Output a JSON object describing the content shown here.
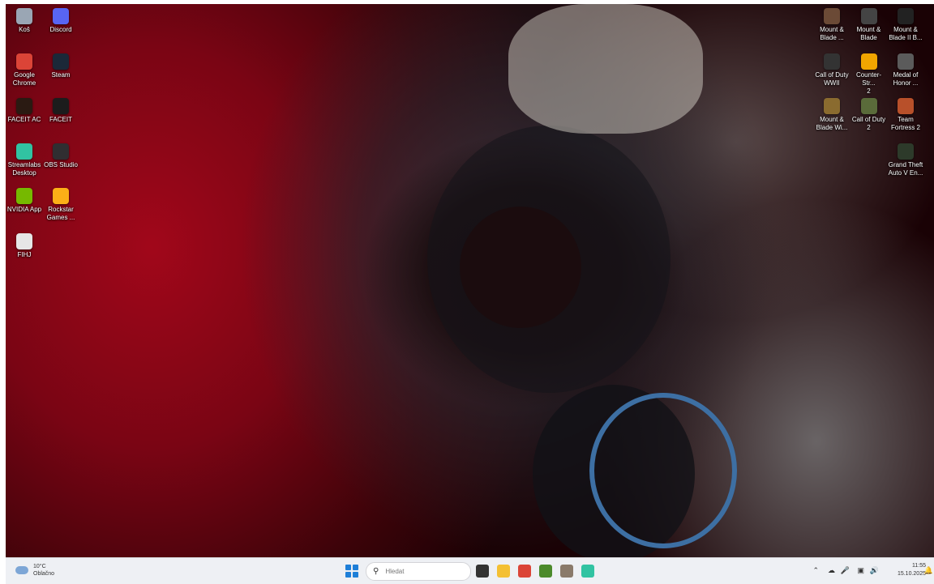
{
  "desktop_icons_left": [
    {
      "label": "Koš",
      "icon": "recycle-bin-icon",
      "color": "#9aa6b4"
    },
    {
      "label": "Discord",
      "icon": "discord-icon",
      "color": "#5865f2"
    },
    {
      "label": "Google\nChrome",
      "icon": "chrome-icon",
      "color": "#db4437"
    },
    {
      "label": "Steam",
      "icon": "steam-icon",
      "color": "#1b2838"
    },
    {
      "label": "FACEIT AC",
      "icon": "faceit-ac-icon",
      "color": "#2a1a12"
    },
    {
      "label": "FACEIT",
      "icon": "faceit-icon",
      "color": "#1c1c1c"
    },
    {
      "label": "Streamlabs\nDesktop",
      "icon": "streamlabs-icon",
      "color": "#31c3a2"
    },
    {
      "label": "OBS Studio",
      "icon": "obs-icon",
      "color": "#302e31"
    },
    {
      "label": "NVIDIA App",
      "icon": "nvidia-icon",
      "color": "#76b900"
    },
    {
      "label": "Rockstar\nGames ...",
      "icon": "rockstar-icon",
      "color": "#fcaf17"
    },
    {
      "label": "FIHJ",
      "icon": "file-icon",
      "color": "#e6e6e6"
    }
  ],
  "desktop_icons_right": [
    {
      "label": "Mount &\nBlade ...",
      "icon": "mount-blade-icon",
      "color": "#6b4a36"
    },
    {
      "label": "Mount &\nBlade",
      "icon": "mount-blade-classic-icon",
      "color": "#444"
    },
    {
      "label": "Mount &\nBlade II B...",
      "icon": "bannerlord-icon",
      "color": "#222"
    },
    {
      "label": "Call of Duty\nWWII",
      "icon": "cod-wwii-icon",
      "color": "#333"
    },
    {
      "label": "Counter-Str...\n2",
      "icon": "cs2-icon",
      "color": "#f0a500"
    },
    {
      "label": "Medal of\nHonor ...",
      "icon": "medal-of-honor-icon",
      "color": "#5b5b5b"
    },
    {
      "label": "Mount &\nBlade Wi...",
      "icon": "warband-icon",
      "color": "#8a6b2f"
    },
    {
      "label": "Call of Duty 2",
      "icon": "cod2-icon",
      "color": "#5a6b3a"
    },
    {
      "label": "Team\nFortress 2",
      "icon": "tf2-icon",
      "color": "#b8502a"
    },
    {
      "label": "Grand Theft\nAuto V En...",
      "icon": "gta-v-icon",
      "color": "#2d3a2a"
    }
  ],
  "taskbar": {
    "weather_temp": "10°C",
    "weather_desc": "Oblačno",
    "search_placeholder": "Hledat",
    "apps": [
      {
        "name": "task-view",
        "color": "#333333"
      },
      {
        "name": "file-explorer",
        "color": "#f4c033"
      },
      {
        "name": "chrome",
        "color": "#db4437"
      },
      {
        "name": "minecraft",
        "color": "#4b8a2b"
      },
      {
        "name": "mount-blade",
        "color": "#8a7a6a"
      },
      {
        "name": "streamlabs",
        "color": "#31c3a2"
      }
    ],
    "time": "11:55",
    "date": "15.10.2025"
  }
}
